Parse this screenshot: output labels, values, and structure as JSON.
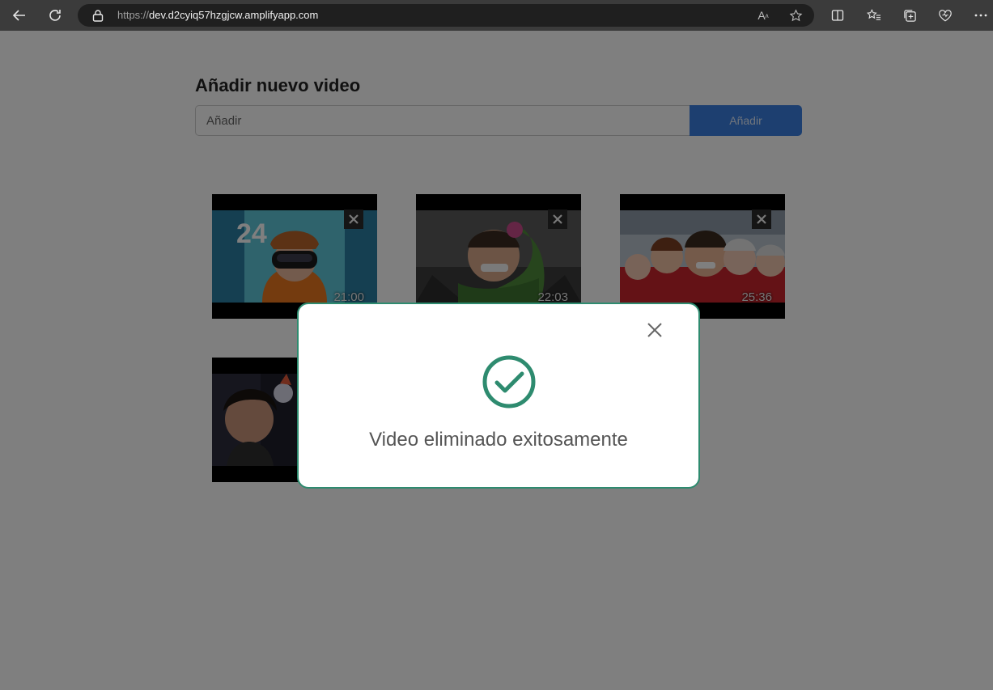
{
  "browser": {
    "url_scheme": "https://",
    "url_host": "dev.d2cyiq57hzgjcw.amplifyapp.com"
  },
  "form": {
    "heading": "Añadir nuevo video",
    "placeholder": "Añadir",
    "button_label": "Añadir"
  },
  "videos": [
    {
      "duration": "21:00"
    },
    {
      "duration": "22:03"
    },
    {
      "duration": "25:36"
    },
    {
      "duration": ""
    }
  ],
  "modal": {
    "message": "Video eliminado exitosamente",
    "accent_color": "#2e8b6f"
  },
  "colors": {
    "button": "#3a7fe0",
    "overlay": "rgba(0,0,0,0.5)"
  }
}
